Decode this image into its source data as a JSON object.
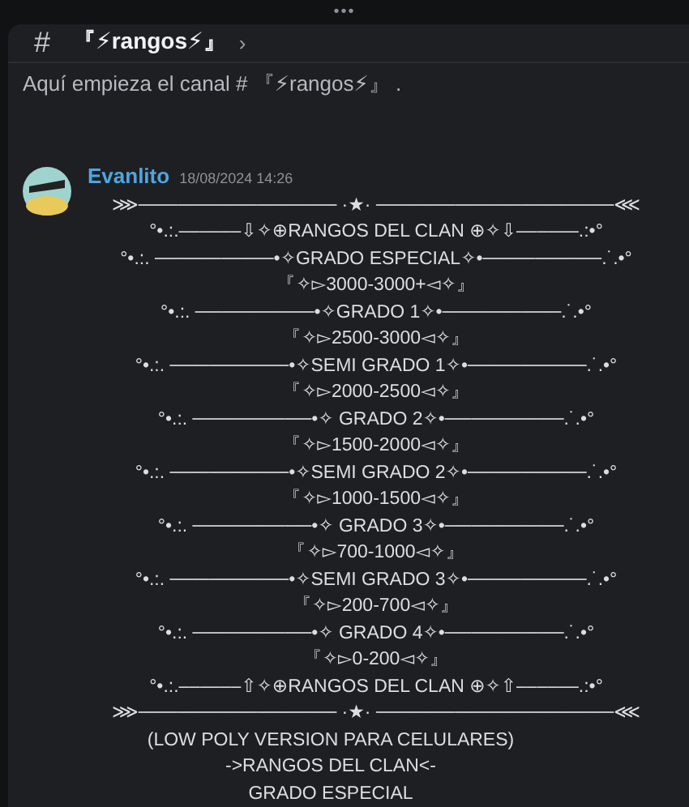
{
  "top_handle": "•••",
  "channel": {
    "hash": "#",
    "name": "『⚡rangos⚡』",
    "chevron": "›"
  },
  "intro": "Aquí empieza el canal # 『⚡rangos⚡』 .",
  "message": {
    "author": "Evanlito",
    "timestamp": "18/08/2024 14:26",
    "lines": [
      "⋙─────────────── ·★· ──────────────────⋘",
      "°•.:.––––––⇩✧⊕RANGOS DEL CLAN ⊕✧⇩––––––.:•°",
      "°•.:. ─────────•✧GRADO ESPECIAL✧•─────────.˙.•°",
      "『✧▻3000-3000+◅✧』",
      "°•.:. ─────────•✧GRADO 1✧•─────────.˙.•°",
      "『✧▻2500-3000◅✧』",
      "°•.:. ─────────•✧SEMI GRADO 1✧•─────────.˙.•°",
      "『✧▻2000-2500◅✧』",
      "°•.:. ─────────•✧ GRADO 2✧•─────────.˙.•°",
      "『✧▻1500-2000◅✧』",
      "°•.:. ─────────•✧SEMI GRADO 2✧•─────────.˙.•°",
      "『✧▻1000-1500◅✧』",
      "°•.:. ─────────•✧ GRADO 3✧•─────────.˙.•°",
      "『✧▻700-1000◅✧』",
      "°•.:. ─────────•✧SEMI GRADO 3✧•─────────.˙.•°",
      "『✧▻200-700◅✧』",
      "°•.:. ─────────•✧ GRADO 4✧•─────────.˙.•°",
      "『✧▻0-200◅✧』",
      "°•.:.––––––⇧✧⊕RANGOS DEL CLAN ⊕✧⇧––––––.:•°",
      "⋙─────────────── ·★· ──────────────────⋘"
    ],
    "trailing_lines": [
      "(LOW POLY VERSION PARA CELULARES)",
      "->RANGOS DEL CLAN<-",
      "GRADO ESPECIAL"
    ]
  }
}
